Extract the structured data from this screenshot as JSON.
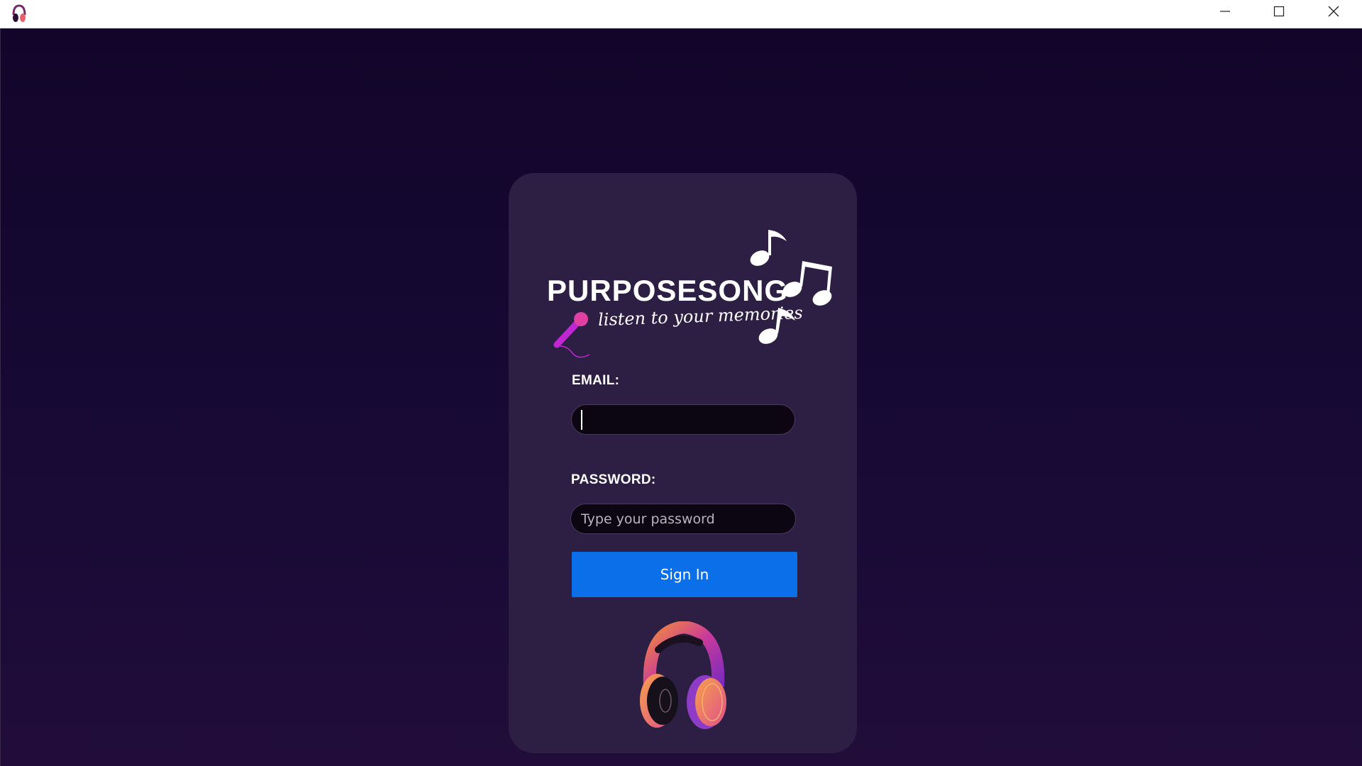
{
  "window": {
    "minimize_icon": "minimize-icon",
    "maximize_icon": "maximize-icon",
    "close_icon": "close-icon",
    "app_icon": "headphones-icon"
  },
  "logo": {
    "title": "PURPOSESONG",
    "tagline": "listen to your memories"
  },
  "form": {
    "email_label": "EMAIL:",
    "email_value": "",
    "password_label": "PASSWORD:",
    "password_placeholder": "Type your password",
    "signin_label": "Sign In"
  },
  "colors": {
    "background": "#150933",
    "card": "#2c1f43",
    "input": "#0c0612",
    "button": "#0a6fe8"
  }
}
